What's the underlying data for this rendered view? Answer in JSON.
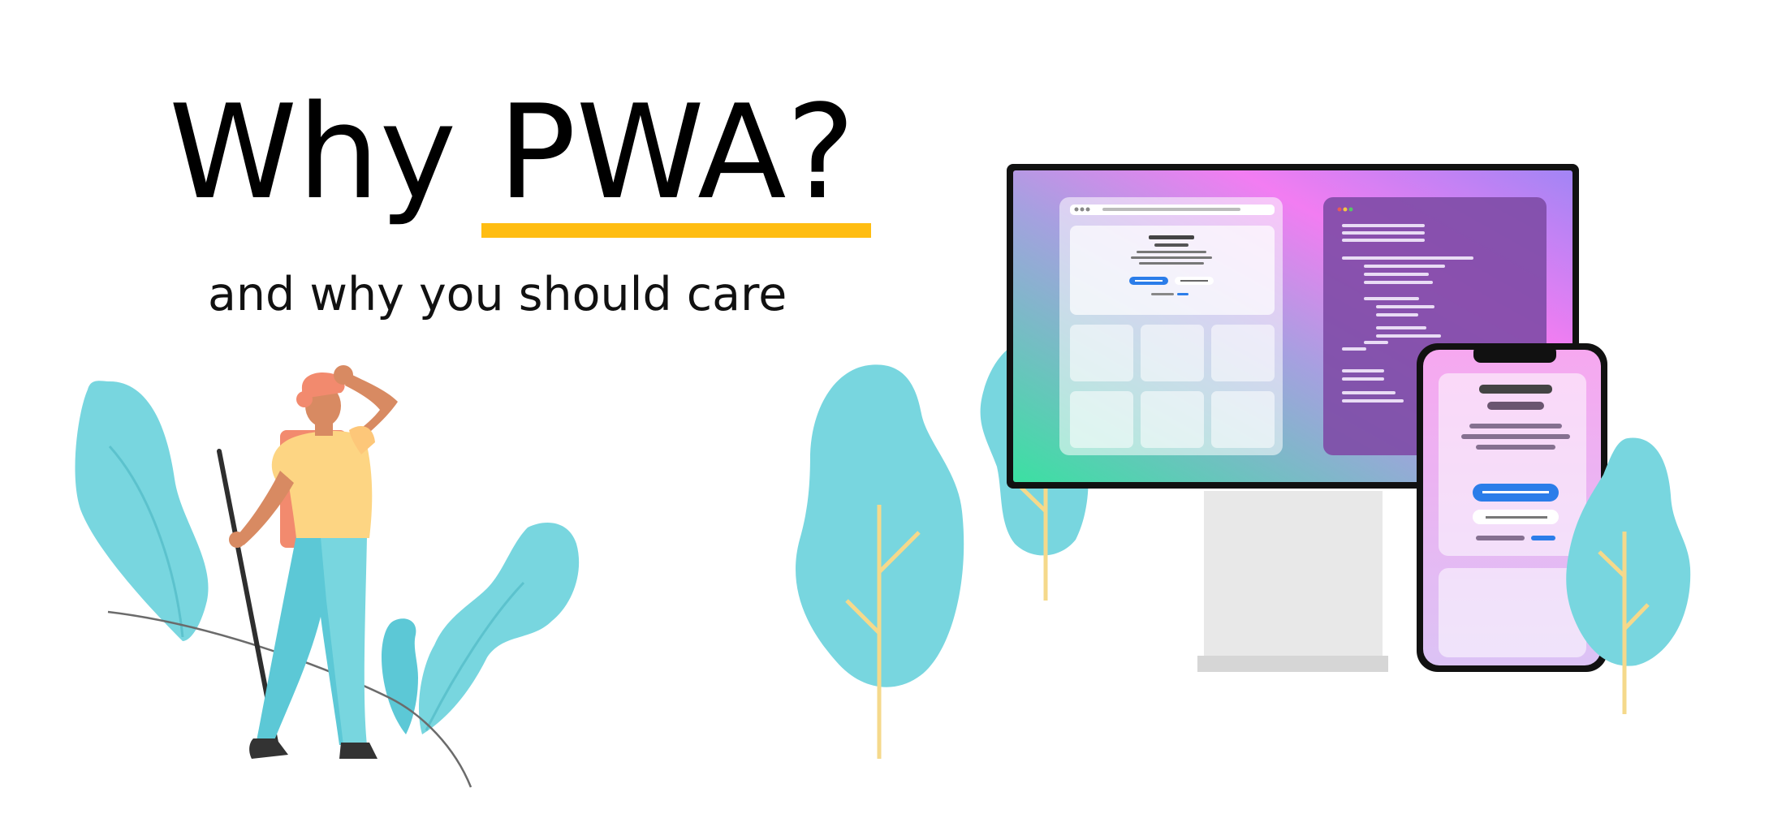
{
  "hero": {
    "title_part1": "Why",
    "title_part2": "PWA?",
    "subtitle": "and why you should care"
  },
  "colors": {
    "accent": "#ffbd12",
    "leaf": "#78d6df",
    "stem": "#f5d98b",
    "gradient_start": "#3be0a2",
    "gradient_mid": "#f27df2",
    "gradient_end": "#a285f5",
    "code_panel": "#7e4ba6",
    "primary_button": "#2b7de9"
  },
  "icons": {
    "window_dots": "traffic-light-dots-icon"
  }
}
